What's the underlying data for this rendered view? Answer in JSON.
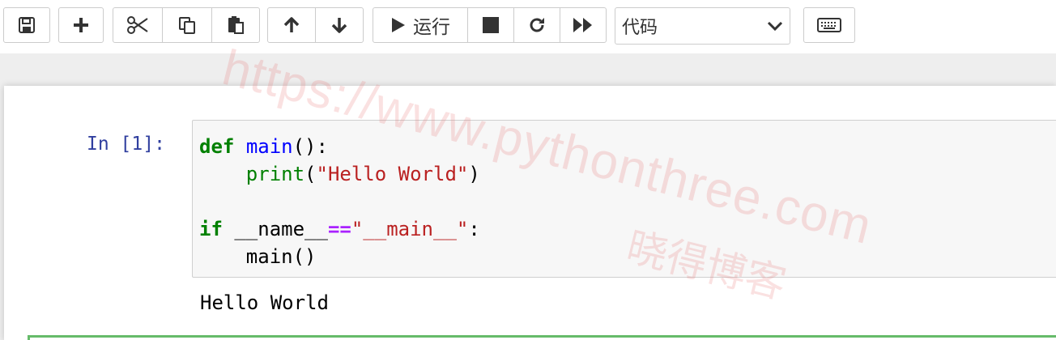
{
  "toolbar": {
    "run_label": "运行",
    "cell_type_selected": "代码",
    "icons": [
      "save-icon",
      "plus-icon",
      "cut-icon",
      "copy-icon",
      "paste-icon",
      "arrow-up-icon",
      "arrow-down-icon",
      "play-icon",
      "stop-icon",
      "restart-icon",
      "fast-forward-icon",
      "chevron-down-icon",
      "keyboard-icon"
    ]
  },
  "cell": {
    "prompt": "In [1]:",
    "code_lines": [
      [
        {
          "t": "def",
          "c": "kw"
        },
        {
          "t": " ",
          "c": ""
        },
        {
          "t": "main",
          "c": "fn"
        },
        {
          "t": "():",
          "c": ""
        }
      ],
      [
        {
          "t": "    ",
          "c": ""
        },
        {
          "t": "print",
          "c": "bi"
        },
        {
          "t": "(",
          "c": ""
        },
        {
          "t": "\"Hello World\"",
          "c": "str"
        },
        {
          "t": ")",
          "c": ""
        }
      ],
      [],
      [
        {
          "t": "if",
          "c": "kw"
        },
        {
          "t": " __name__",
          "c": ""
        },
        {
          "t": "==",
          "c": "op"
        },
        {
          "t": "\"__main__\"",
          "c": "str"
        },
        {
          "t": ":",
          "c": ""
        }
      ],
      [
        {
          "t": "    main()",
          "c": ""
        }
      ]
    ],
    "output": "Hello World"
  },
  "watermark": {
    "url": "https://www.pythonthree.com",
    "name": "晓得博客"
  },
  "colors": {
    "prompt_in": "#303f9f",
    "keyword": "#008000",
    "function": "#0000ff",
    "string": "#ba2121",
    "operator": "#aa22ff",
    "selected_cell_border": "#66bb6a"
  }
}
